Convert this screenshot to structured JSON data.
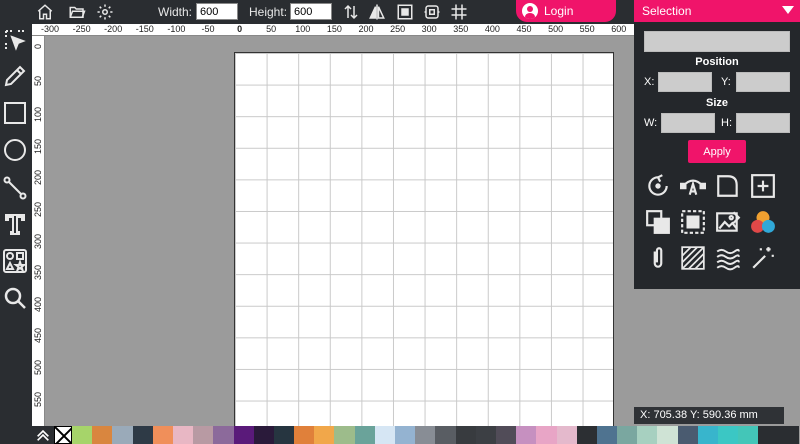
{
  "topbar": {
    "width_label": "Width:",
    "width_value": "600",
    "height_label": "Height:",
    "height_value": "600",
    "login_label": "Login",
    "icons": [
      "home-icon",
      "folder-open-icon",
      "settings-gear-icon",
      "swap-vertical-icon",
      "flip-icon",
      "fit-page-icon",
      "resize-icon",
      "crop-grid-icon"
    ]
  },
  "ruler": {
    "horizontal": [
      "-300",
      "-250",
      "-200",
      "-150",
      "-100",
      "-50",
      "0",
      "50",
      "100",
      "150",
      "200",
      "250",
      "300",
      "350",
      "400",
      "450",
      "500",
      "550",
      "600"
    ],
    "vertical": [
      "0",
      "50",
      "100",
      "150",
      "200",
      "250",
      "300",
      "350",
      "400",
      "450",
      "500",
      "550"
    ]
  },
  "left_tools": [
    "select-arrow-icon",
    "pencil-icon",
    "rectangle-icon",
    "circle-icon",
    "line-icon",
    "text-icon",
    "shapes-library-icon",
    "zoom-icon"
  ],
  "panel": {
    "header": "Selection",
    "position_heading": "Position",
    "x_label": "X:",
    "y_label": "Y:",
    "size_heading": "Size",
    "w_label": "W:",
    "h_label": "H:",
    "apply_label": "Apply",
    "tool_icons": [
      "rotate-icon",
      "edit-curve-icon",
      "corner-radius-icon",
      "add-square-icon",
      "arrange-layers-icon",
      "group-select-icon",
      "image-edit-icon",
      "color-blend-icon",
      "paperclip-icon",
      "hatch-fill-icon",
      "wave-fill-icon",
      "magic-wand-icon"
    ]
  },
  "status": {
    "coords": "X: 705.38 Y: 590.36 mm"
  },
  "palette": {
    "colors": [
      "#a6d46a",
      "#d9863f",
      "#9aaab9",
      "#2e3a46",
      "#f08f5a",
      "#e8b7c4",
      "#b89aa3",
      "#8c6a9b",
      "#5a1a7a",
      "#2a1a3a",
      "#263540",
      "#e0803a",
      "#f1a74a",
      "#9dbc8b",
      "#6aa39a",
      "#d6e6f4",
      "#94b3d1",
      "#888d95",
      "#595d63",
      "#383b3f",
      "#3c3f44",
      "#514c58",
      "#c690c0",
      "#e8a5c6",
      "#e4b9cc",
      "#2c2f33",
      "#4f7390",
      "#7aa7a0",
      "#a7d0c0",
      "#cfe3d5",
      "#4a5b70",
      "#38b5cc",
      "#3bc7c4",
      "#43c6b8",
      "#2a2d31",
      "#2a2d31"
    ]
  }
}
